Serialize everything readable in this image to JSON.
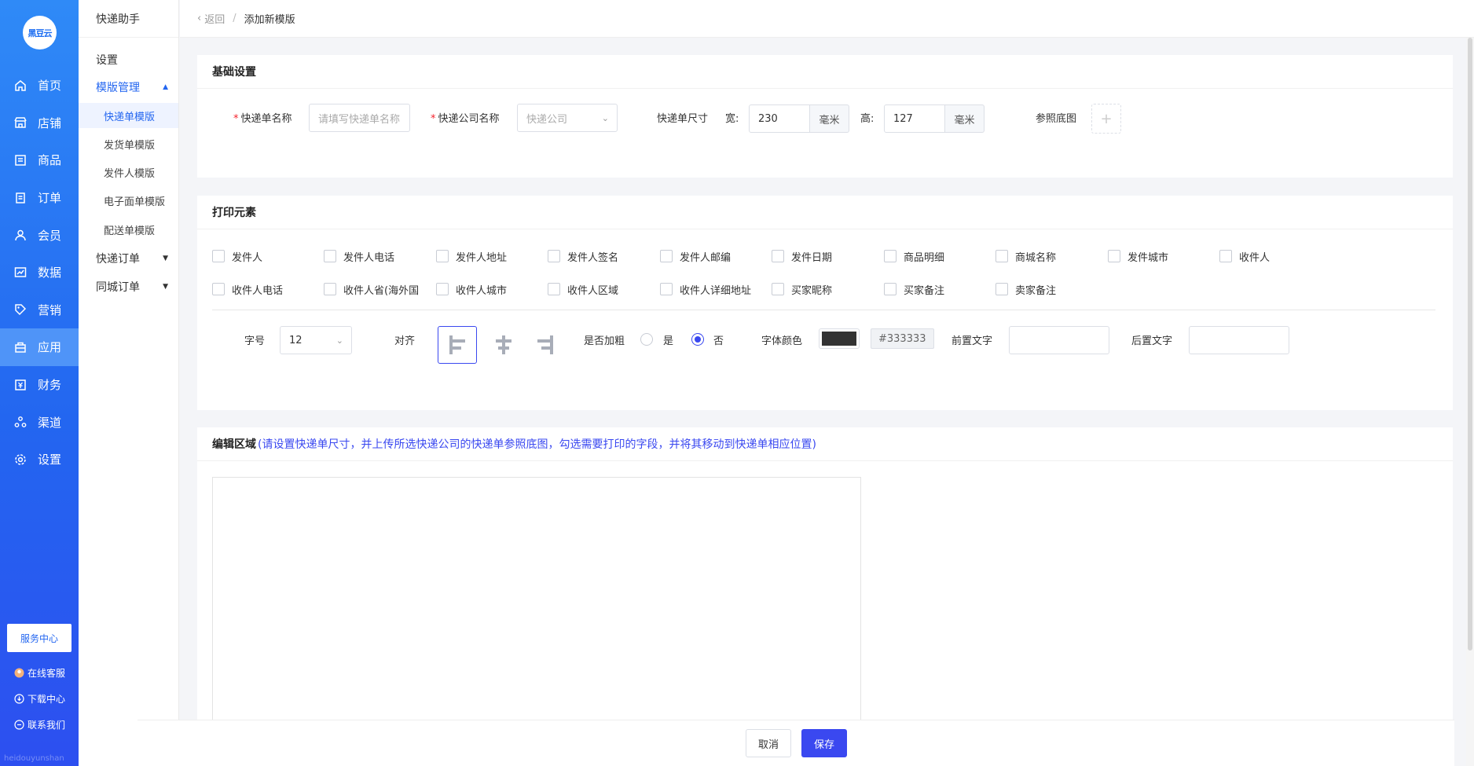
{
  "brand": {
    "logo_text": "黑豆云"
  },
  "nav": {
    "items": [
      {
        "label": "首页",
        "icon": "home-icon"
      },
      {
        "label": "店铺",
        "icon": "store-icon"
      },
      {
        "label": "商品",
        "icon": "goods-icon"
      },
      {
        "label": "订单",
        "icon": "order-icon"
      },
      {
        "label": "会员",
        "icon": "user-icon"
      },
      {
        "label": "数据",
        "icon": "chart-icon"
      },
      {
        "label": "营销",
        "icon": "tag-icon"
      },
      {
        "label": "应用",
        "icon": "app-icon"
      },
      {
        "label": "财务",
        "icon": "finance-icon"
      },
      {
        "label": "渠道",
        "icon": "channel-icon"
      },
      {
        "label": "设置",
        "icon": "gear-icon"
      }
    ],
    "active_index": 7,
    "service_center": "服务中心",
    "footer_links": [
      "在线客服",
      "下载中心",
      "联系我们"
    ],
    "watermark": "heidouyunshan"
  },
  "submenu": {
    "title": "快递助手",
    "settings": "设置",
    "template_mgmt": "模版管理",
    "template_items": [
      "快递单模版",
      "发货单模版",
      "发件人模版",
      "电子面单模版",
      "配送单模版"
    ],
    "express_orders": "快递订单",
    "city_orders": "同城订单"
  },
  "breadcrumb": {
    "back": "返回",
    "sep": "/",
    "current": "添加新模版"
  },
  "basic": {
    "title": "基础设置",
    "name_label": "快递单名称",
    "name_placeholder": "请填写快递单名称",
    "company_label": "快递公司名称",
    "company_placeholder": "快递公司",
    "size_label": "快递单尺寸",
    "width_label": "宽:",
    "width_value": "230",
    "height_label": "高:",
    "height_value": "127",
    "unit": "毫米",
    "ref_label": "参照底图",
    "upload_glyph": "+"
  },
  "print": {
    "title": "打印元素",
    "fields_row1": [
      "发件人",
      "发件人电话",
      "发件人地址",
      "发件人签名",
      "发件人邮编",
      "发件日期",
      "商品明细",
      "商城名称",
      "发件城市",
      "收件人"
    ],
    "fields_row2": [
      "收件人电话",
      "收件人省(海外国",
      "收件人城市",
      "收件人区域",
      "收件人详细地址",
      "买家昵称",
      "买家备注",
      "卖家备注"
    ],
    "font_size_label": "字号",
    "font_size_value": "12",
    "align_label": "对齐",
    "bold_label": "是否加粗",
    "bold_yes": "是",
    "bold_no": "否",
    "font_color_label": "字体颜色",
    "font_color_value": "#333333",
    "prefix_label": "前置文字",
    "suffix_label": "后置文字"
  },
  "edit": {
    "title": "编辑区域",
    "hint": "(请设置快递单尺寸，并上传所选快递公司的快递单参照底图，勾选需要打印的字段，并将其移动到快递单相应位置)"
  },
  "footer": {
    "cancel": "取消",
    "save": "保存"
  },
  "colors": {
    "primary": "#3a48f0",
    "sidebar": "#2366f0",
    "required": "#f5222d"
  }
}
